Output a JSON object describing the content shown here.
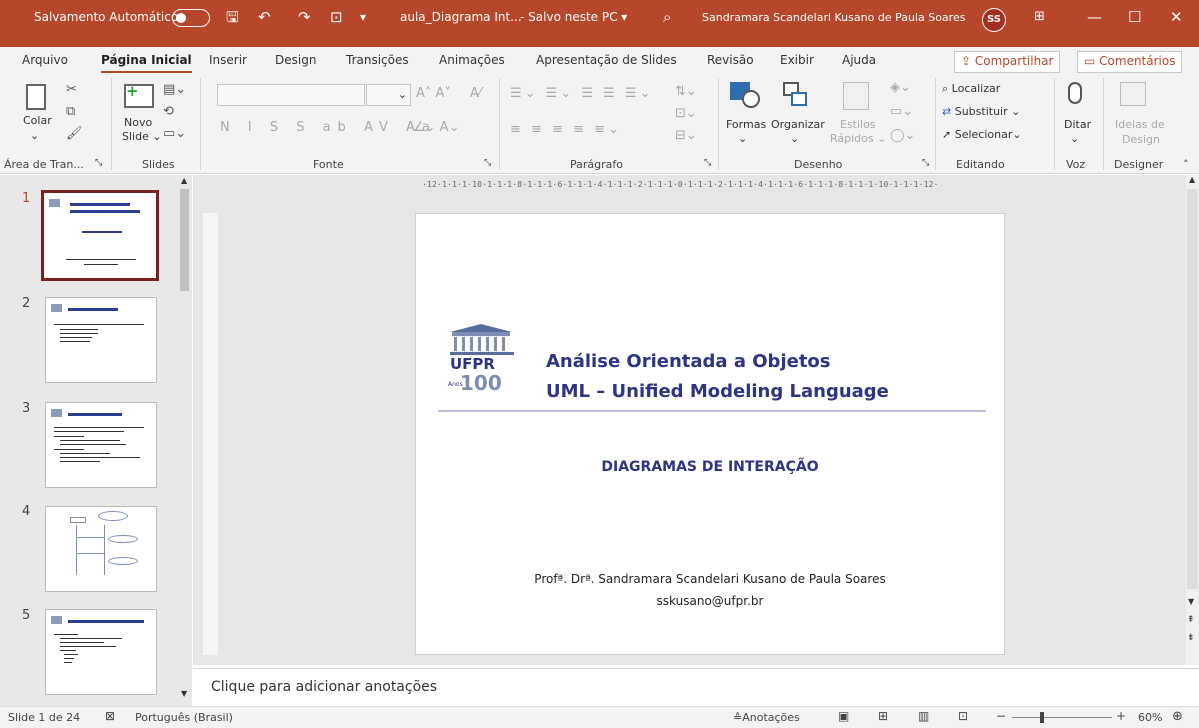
{
  "titlebar": {
    "autosave_label": "Salvamento Automático",
    "doc_name": "aula_Diagrama Int...",
    "save_status": "Salvo neste PC",
    "user_name": "Sandramara Scandelari Kusano de Paula Soares",
    "user_initials": "SS"
  },
  "menu_tabs": [
    "Arquivo",
    "Página Inicial",
    "Inserir",
    "Design",
    "Transições",
    "Animações",
    "Apresentação de Slides",
    "Revisão",
    "Exibir",
    "Ajuda"
  ],
  "active_tab": "Página Inicial",
  "share_label": "Compartilhar",
  "comments_label": "Comentários",
  "ribbon": {
    "clipboard": {
      "paste": "Colar",
      "group": "Área de Tran..."
    },
    "slides": {
      "new_slide_1": "Novo",
      "new_slide_2": "Slide",
      "group": "Slides"
    },
    "font": {
      "group": "Fonte"
    },
    "paragraph": {
      "group": "Parágrafo"
    },
    "drawing": {
      "shapes": "Formas",
      "arrange": "Organizar",
      "quick_styles_1": "Estilos",
      "quick_styles_2": "Rápidos",
      "group": "Desenho"
    },
    "editing": {
      "find": "Localizar",
      "replace": "Substituir",
      "select": "Selecionar",
      "group": "Editando"
    },
    "voice": {
      "dictate": "Ditar",
      "group": "Voz"
    },
    "designer": {
      "ideas_1": "Ideias de",
      "ideas_2": "Design",
      "group": "Designer"
    }
  },
  "ruler_h": "·12·1·1·1·10·1·1·1·8·1·1·1·6·1·1·1·4·1·1·1·2·1·1·1·0·1·1·1·2·1·1·1·4·1·1·1·6·1·1·1·8·1·1·1·10·1·1·1·12·",
  "thumbnails": [
    {
      "num": "1",
      "title": "Análise Orientada a Objetos UML - Unified Modeling Language",
      "subtitle": "DIAGRAMAS DE INTERAÇÃO"
    },
    {
      "num": "2",
      "title": "Diagramas de Interação"
    },
    {
      "num": "3",
      "title": "Diagrama de Sequência"
    },
    {
      "num": "4",
      "title": ""
    },
    {
      "num": "5",
      "title": "Diagrama de Sequência - Representação"
    }
  ],
  "slide": {
    "logo_text": "UFPR",
    "logo_number": "100",
    "logo_sub": "Anos",
    "title_line1": "Análise Orientada a Objetos",
    "title_line2": "UML – Unified Modeling Language",
    "subtitle": "DIAGRAMAS DE INTERAÇÃO",
    "author": "Profª. Drª. Sandramara Scandelari Kusano de Paula Soares",
    "email": "sskusano@ufpr.br"
  },
  "notes_placeholder": "Clique para adicionar anotações",
  "status": {
    "slide_info": "Slide 1 de 24",
    "language": "Português (Brasil)",
    "notes_label": "Anotações",
    "zoom": "60%"
  },
  "colors": {
    "accent": "#b7472a",
    "slide_title": "#2c3483",
    "thumb_selected": "#7a1f1f"
  }
}
